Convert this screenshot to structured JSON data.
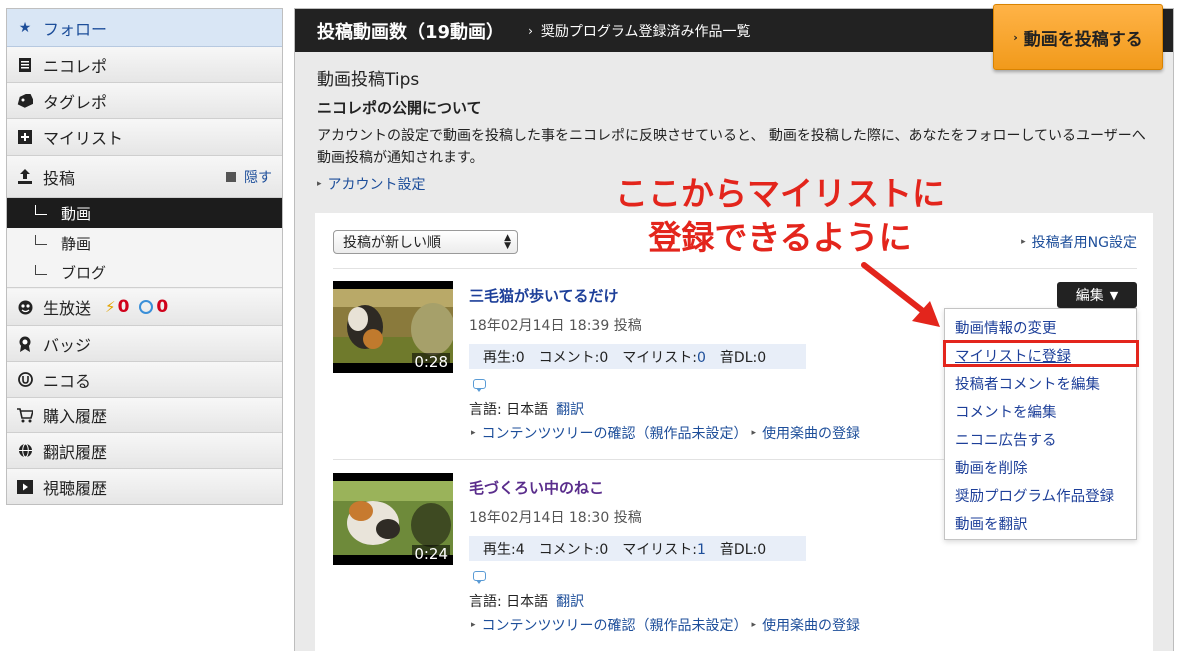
{
  "sidebar": {
    "items": [
      {
        "label": "フォロー",
        "icon": "star-icon"
      },
      {
        "label": "ニコレポ",
        "icon": "document-icon"
      },
      {
        "label": "タグレポ",
        "icon": "tag-icon"
      },
      {
        "label": "マイリスト",
        "icon": "mylist-icon"
      },
      {
        "label": "投稿",
        "icon": "upload-icon",
        "hide_label": "隠す"
      },
      {
        "label": "生放送",
        "icon": "live-icon",
        "count_bolt": "0",
        "count_clock": "0"
      },
      {
        "label": "バッジ",
        "icon": "badge-icon"
      },
      {
        "label": "ニコる",
        "icon": "nicoru-icon"
      },
      {
        "label": "購入履歴",
        "icon": "cart-icon"
      },
      {
        "label": "翻訳履歴",
        "icon": "globe-icon"
      },
      {
        "label": "視聴履歴",
        "icon": "play-icon"
      }
    ],
    "sub_items": [
      "動画",
      "静画",
      "ブログ"
    ]
  },
  "header": {
    "title": "投稿動画数（19動画）",
    "link": "奨励プログラム登録済み作品一覧",
    "post_button": "動画を投稿する"
  },
  "tips": {
    "title": "動画投稿Tips",
    "subtitle": "ニコレポの公開について",
    "text": "アカウントの設定で動画を投稿した事をニコレポに反映させていると、 動画を投稿した際に、あなたをフォローしているユーザーへ動画投稿が通知されます。",
    "link": "アカウント設定"
  },
  "list": {
    "sort_value": "投稿が新しい順",
    "ng_link": "投稿者用NG設定",
    "edit_button": "編集",
    "videos": [
      {
        "title": "三毛猫が歩いてるだけ",
        "duration": "0:28",
        "date": "18年02月14日 18:39 投稿",
        "play_label": "再生:",
        "play": "0",
        "comment_label": "コメント:",
        "comment": "0",
        "mylist_label": "マイリスト:",
        "mylist": "0",
        "audio_label": "音DL:",
        "audio": "0",
        "lang_label": "言語: 日本語",
        "translate": "翻訳",
        "tree_link": "コンテンツツリーの確認（親作品未設定）",
        "music_link": "使用楽曲の登録"
      },
      {
        "title": "毛づくろい中のねこ",
        "duration": "0:24",
        "date": "18年02月14日 18:30 投稿",
        "play_label": "再生:",
        "play": "4",
        "comment_label": "コメント:",
        "comment": "0",
        "mylist_label": "マイリスト:",
        "mylist": "1",
        "audio_label": "音DL:",
        "audio": "0",
        "lang_label": "言語: 日本語",
        "translate": "翻訳",
        "tree_link": "コンテンツツリーの確認（親作品未設定）",
        "music_link": "使用楽曲の登録"
      }
    ]
  },
  "edit_menu": [
    "動画情報の変更",
    "マイリストに登録",
    "投稿者コメントを編集",
    "コメントを編集",
    "ニコニ広告する",
    "動画を削除",
    "奨励プログラム作品登録",
    "動画を翻訳"
  ],
  "annotation": {
    "line1": "ここからマイリストに",
    "line2": "登録できるように"
  },
  "colors": {
    "accent_orange": "#f5a42a",
    "annotation_red": "#e3251c",
    "link_blue": "#1d4e9a",
    "header_dark": "#222222"
  }
}
